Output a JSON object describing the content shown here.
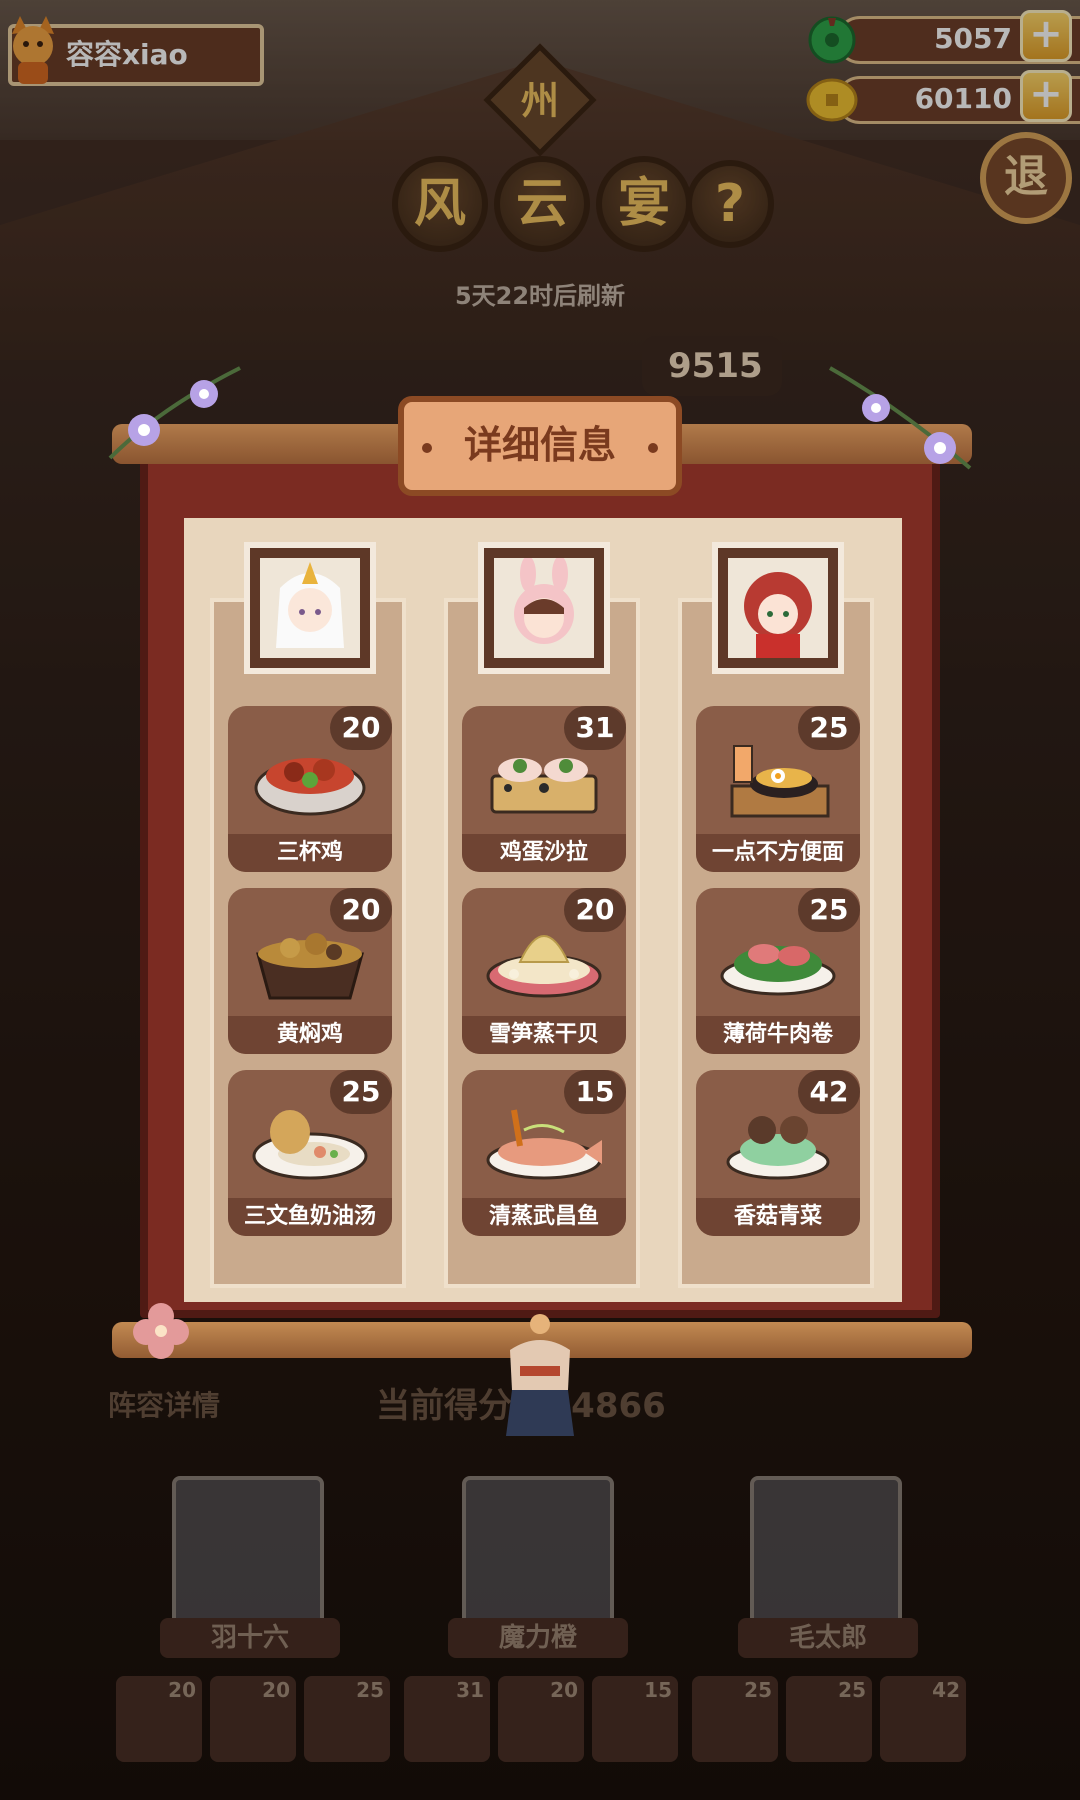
{
  "user": {
    "name": "容容xiao",
    "avatar_icon": "fox-avatar-icon"
  },
  "resources": [
    {
      "name": "jade",
      "value": "5057",
      "icon": "jade-coin-icon",
      "color": "#2fa64a"
    },
    {
      "name": "gold",
      "value": "60110",
      "icon": "gold-coin-icon",
      "color": "#f1c232"
    }
  ],
  "plus_label": "+",
  "header": {
    "sign": "州",
    "title_chars": [
      "风",
      "云",
      "宴"
    ],
    "help": "?",
    "exit": "退",
    "refresh_text": "5天22时后刷新"
  },
  "behind_score": "9515",
  "panel": {
    "title": "详细信息",
    "columns": [
      {
        "character": "羽十六",
        "dishes": [
          {
            "name": "三杯鸡",
            "score": "20"
          },
          {
            "name": "黄焖鸡",
            "score": "20"
          },
          {
            "name": "三文鱼奶油汤",
            "score": "25"
          }
        ]
      },
      {
        "character": "魔力橙",
        "dishes": [
          {
            "name": "鸡蛋沙拉",
            "score": "31"
          },
          {
            "name": "雪笋蒸干贝",
            "score": "20"
          },
          {
            "name": "清蒸武昌鱼",
            "score": "15"
          }
        ]
      },
      {
        "character": "毛太郎",
        "dishes": [
          {
            "name": "一点不方便面",
            "score": "25"
          },
          {
            "name": "薄荷牛肉卷",
            "score": "25"
          },
          {
            "name": "香菇青菜",
            "score": "42"
          }
        ]
      }
    ]
  },
  "bottom": {
    "lineup_label": "阵容详情",
    "current_score_label": "当前得分",
    "current_score_value": "444866",
    "characters": [
      "羽十六",
      "魔力橙",
      "毛太郎"
    ],
    "slot_scores": [
      "20",
      "20",
      "25",
      "31",
      "20",
      "15",
      "25",
      "25",
      "42"
    ]
  },
  "colors": {
    "accent": "#e7a678",
    "frame": "#7b2b22",
    "paper": "#e8d6bd"
  }
}
